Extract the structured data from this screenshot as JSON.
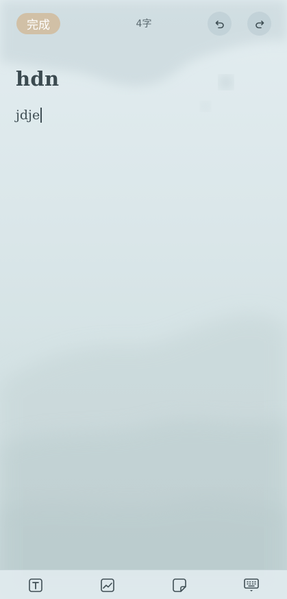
{
  "toolbar": {
    "done_label": "完成",
    "word_count": "4字",
    "undo_icon": "undo-icon",
    "redo_icon": "redo-icon"
  },
  "note": {
    "title": "hdn",
    "body": "jdje"
  },
  "bottom_tools": [
    "text-format-icon",
    "image-icon",
    "sticky-note-icon",
    "keyboard-hide-icon"
  ],
  "colors": {
    "done_button": "#d1c0a6",
    "icon": "#3f4e54",
    "background": "#dbe7ea"
  }
}
